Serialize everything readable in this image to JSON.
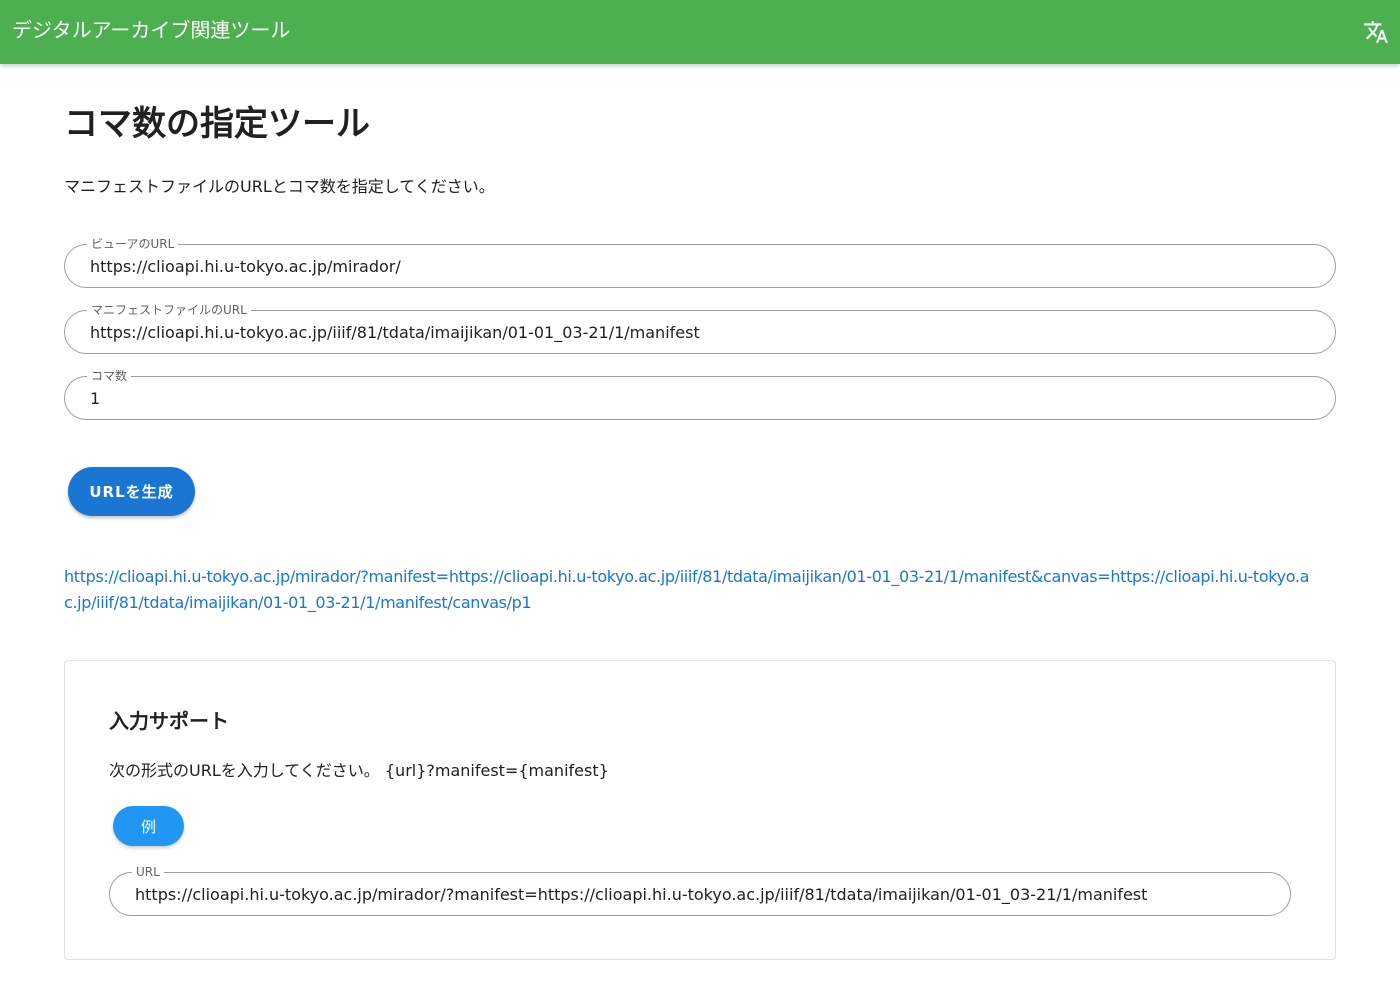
{
  "appbar": {
    "title": "デジタルアーカイブ関連ツール",
    "translate_icon": "translate-icon"
  },
  "main": {
    "title": "コマ数の指定ツール",
    "lead": "マニフェストファイルのURLとコマ数を指定してください。",
    "fields": {
      "viewer_url": {
        "label": "ビューアのURL",
        "value": "https://clioapi.hi.u-tokyo.ac.jp/mirador/"
      },
      "manifest_url": {
        "label": "マニフェストファイルのURL",
        "value": "https://clioapi.hi.u-tokyo.ac.jp/iiif/81/tdata/imaijikan/01-01_03-21/1/manifest"
      },
      "frame_count": {
        "label": "コマ数",
        "value": "1"
      }
    },
    "generate_label": "URLを生成",
    "result_url": "https://clioapi.hi.u-tokyo.ac.jp/mirador/?manifest=https://clioapi.hi.u-tokyo.ac.jp/iiif/81/tdata/imaijikan/01-01_03-21/1/manifest&canvas=https://clioapi.hi.u-tokyo.ac.jp/iiif/81/tdata/imaijikan/01-01_03-21/1/manifest/canvas/p1"
  },
  "support": {
    "title": "入力サポート",
    "description": "次の形式のURLを入力してください。 {url}?manifest={manifest}",
    "example_label": "例",
    "url_field": {
      "label": "URL",
      "value": "https://clioapi.hi.u-tokyo.ac.jp/mirador/?manifest=https://clioapi.hi.u-tokyo.ac.jp/iiif/81/tdata/imaijikan/01-01_03-21/1/manifest"
    }
  },
  "colors": {
    "appbar": "#4caf50",
    "primary": "#1976d2",
    "secondary": "#2196f3"
  }
}
